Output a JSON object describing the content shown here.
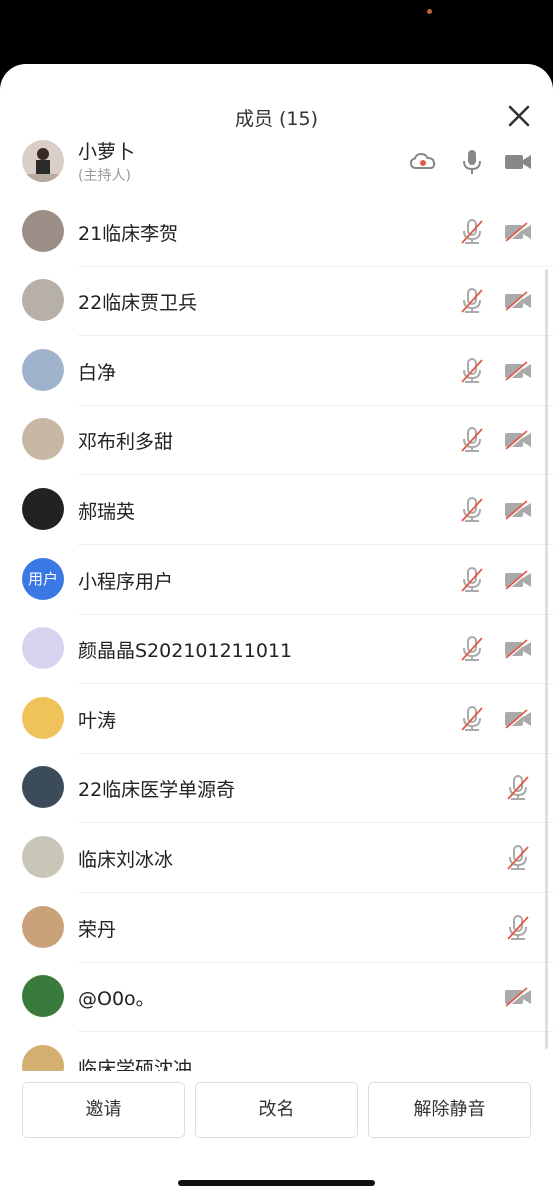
{
  "header": {
    "title": "成员 (15)"
  },
  "host": {
    "name": "小萝卜",
    "role": "(主持人)"
  },
  "members": [
    {
      "name": "21临床李贺",
      "mic": "muted",
      "cam": "off",
      "avatar_color": "#9b8e86"
    },
    {
      "name": "22临床贾卫兵",
      "mic": "muted",
      "cam": "off",
      "avatar_color": "#b7b0a6"
    },
    {
      "name": "白净",
      "mic": "muted",
      "cam": "off",
      "avatar_color": "#9fb4cc"
    },
    {
      "name": "邓布利多甜",
      "mic": "muted",
      "cam": "off",
      "avatar_color": "#c7b7a4"
    },
    {
      "name": "郝瑞英",
      "mic": "muted",
      "cam": "off",
      "avatar_color": "#222222"
    },
    {
      "name": "小程序用户",
      "mic": "muted",
      "cam": "off",
      "avatar_color": "#3a78e6",
      "avatar_text": "用户"
    },
    {
      "name": "颜晶晶S202101211011",
      "mic": "muted",
      "cam": "off",
      "avatar_color": "#d8d4f0"
    },
    {
      "name": "叶涛",
      "mic": "muted",
      "cam": "off",
      "avatar_color": "#f0c25a"
    },
    {
      "name": "22临床医学单源奇",
      "mic": "muted",
      "cam": "none",
      "avatar_color": "#3b4b5a"
    },
    {
      "name": "临床刘冰冰",
      "mic": "muted",
      "cam": "none",
      "avatar_color": "#c9c6b8"
    },
    {
      "name": "荣丹",
      "mic": "muted",
      "cam": "none",
      "avatar_color": "#c9a27a"
    },
    {
      "name": "@O0o。",
      "mic": "none",
      "cam": "off",
      "avatar_color": "#3a7a3a"
    },
    {
      "name": "临床学硕沈冲",
      "mic": "none",
      "cam": "none",
      "avatar_color": "#d4b070"
    }
  ],
  "buttons": {
    "invite": "邀请",
    "rename": "改名",
    "unmute": "解除静音"
  },
  "colors": {
    "muted_red": "#e25a4a",
    "icon_gray": "#888888",
    "accent_blue": "#3a78e6"
  }
}
